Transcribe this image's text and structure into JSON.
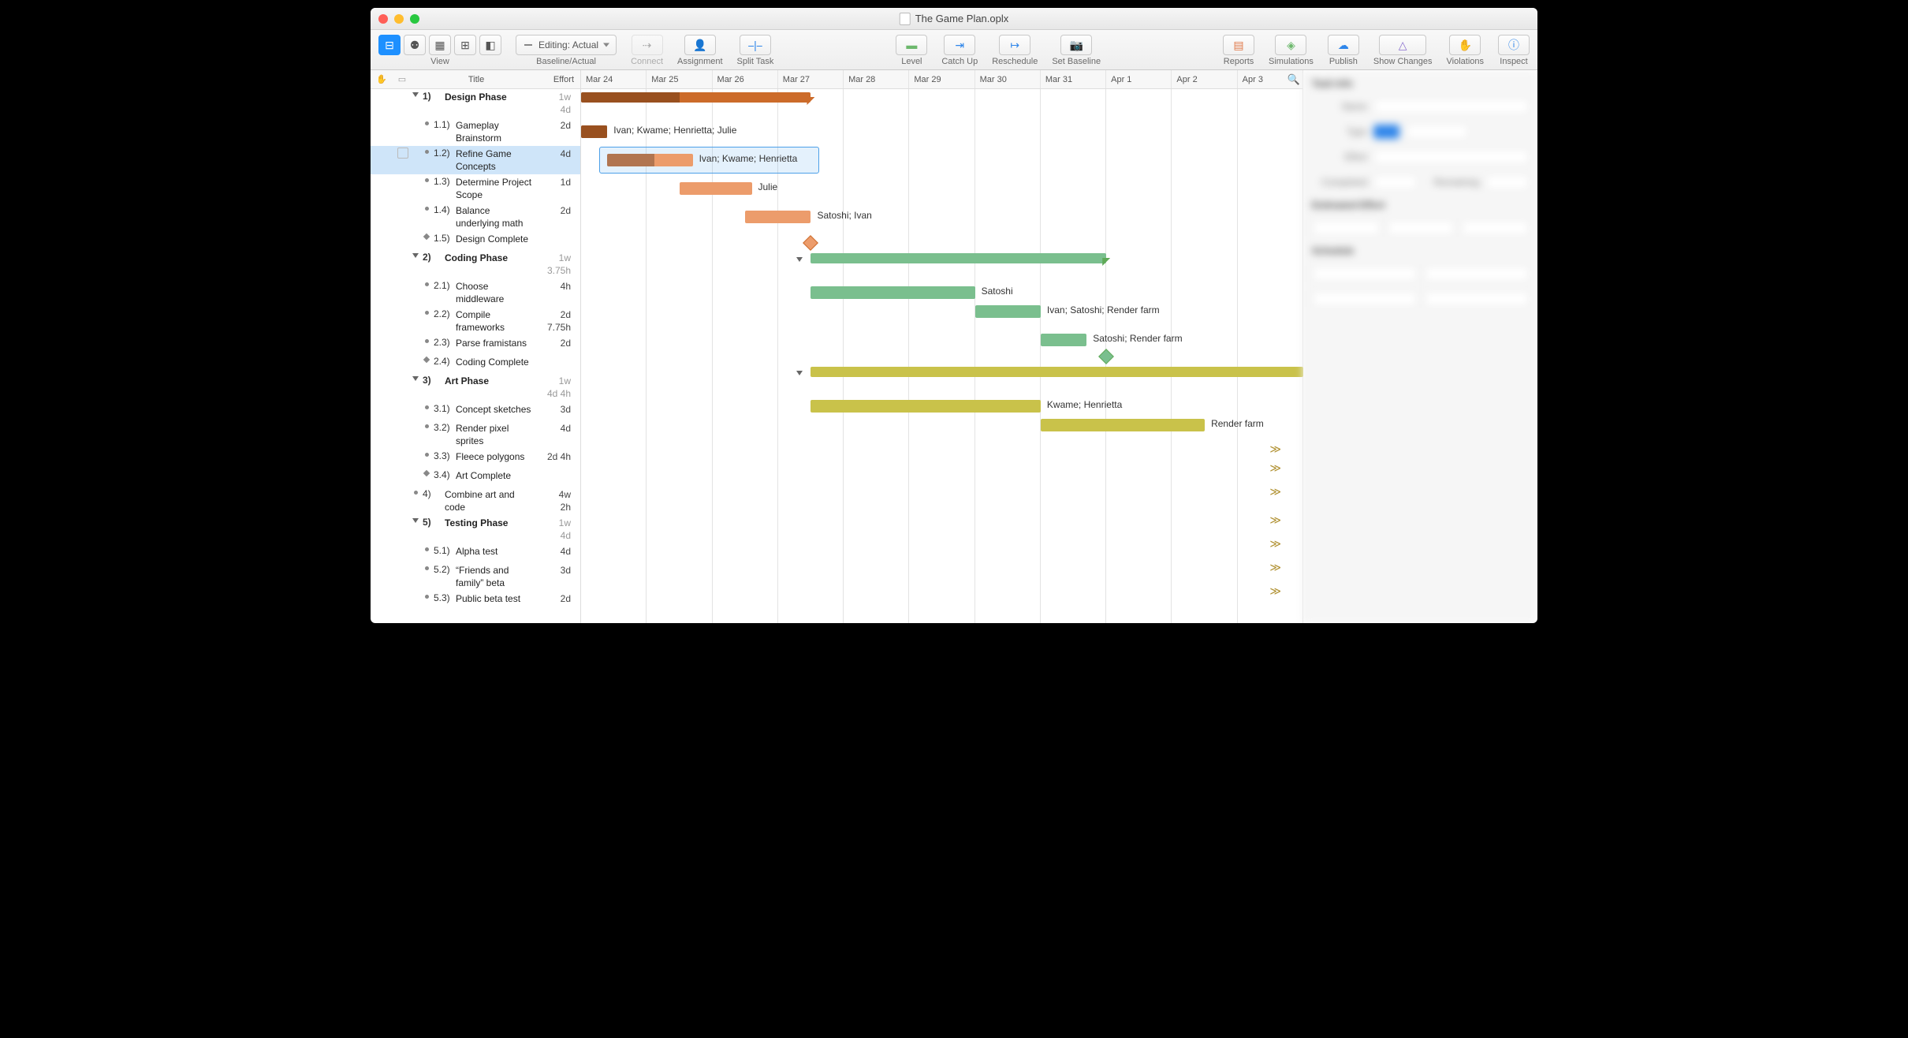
{
  "window": {
    "title": "The Game Plan.oplx"
  },
  "toolbar": {
    "view_label": "View",
    "baseline_label": "Baseline/Actual",
    "baseline_dropdown": "Editing: Actual",
    "connect_label": "Connect",
    "assignment_label": "Assignment",
    "split_label": "Split Task",
    "level_label": "Level",
    "catchup_label": "Catch Up",
    "reschedule_label": "Reschedule",
    "setbaseline_label": "Set Baseline",
    "reports_label": "Reports",
    "simulations_label": "Simulations",
    "publish_label": "Publish",
    "showchanges_label": "Show Changes",
    "violations_label": "Violations",
    "inspect_label": "Inspect"
  },
  "outline_header": {
    "title": "Title",
    "effort": "Effort"
  },
  "gantt_header": {
    "dates": [
      "Mar 24",
      "Mar 25",
      "Mar 26",
      "Mar 27",
      "Mar 28",
      "Mar 29",
      "Mar 30",
      "Mar 31",
      "Apr 1",
      "Apr 2",
      "Apr 3"
    ]
  },
  "rows": [
    {
      "id": "1",
      "type": "group",
      "num": "1)",
      "title": "Design Phase",
      "eff": "1w",
      "eff2": "4d"
    },
    {
      "id": "1.1",
      "type": "task",
      "num": "1.1)",
      "title": "Gameplay Brainstorm",
      "eff": "2d"
    },
    {
      "id": "1.2",
      "type": "task",
      "num": "1.2)",
      "title": "Refine Game Concepts",
      "eff": "4d",
      "selected": true
    },
    {
      "id": "1.3",
      "type": "task",
      "num": "1.3)",
      "title": "Determine Project Scope",
      "eff": "1d"
    },
    {
      "id": "1.4",
      "type": "task",
      "num": "1.4)",
      "title": "Balance underlying math",
      "eff": "2d"
    },
    {
      "id": "1.5",
      "type": "mile",
      "num": "1.5)",
      "title": "Design Complete",
      "eff": ""
    },
    {
      "id": "2",
      "type": "group",
      "num": "2)",
      "title": "Coding Phase",
      "eff": "1w",
      "eff2": "3.75h"
    },
    {
      "id": "2.1",
      "type": "task",
      "num": "2.1)",
      "title": "Choose middleware",
      "eff": "4h"
    },
    {
      "id": "2.2",
      "type": "task",
      "num": "2.2)",
      "title": "Compile frameworks",
      "eff": "2d",
      "eff2": "7.75h"
    },
    {
      "id": "2.3",
      "type": "task",
      "num": "2.3)",
      "title": "Parse framistans",
      "eff": "2d"
    },
    {
      "id": "2.4",
      "type": "mile",
      "num": "2.4)",
      "title": "Coding Complete",
      "eff": ""
    },
    {
      "id": "3",
      "type": "group",
      "num": "3)",
      "title": "Art Phase",
      "eff": "1w",
      "eff2": "4d 4h"
    },
    {
      "id": "3.1",
      "type": "task",
      "num": "3.1)",
      "title": "Concept sketches",
      "eff": "3d"
    },
    {
      "id": "3.2",
      "type": "task",
      "num": "3.2)",
      "title": "Render pixel sprites",
      "eff": "4d"
    },
    {
      "id": "3.3",
      "type": "task",
      "num": "3.3)",
      "title": "Fleece polygons",
      "eff": "2d 4h"
    },
    {
      "id": "3.4",
      "type": "mile",
      "num": "3.4)",
      "title": "Art Complete",
      "eff": ""
    },
    {
      "id": "4",
      "type": "task",
      "num": "4)",
      "title": "Combine art and code",
      "eff": "4w",
      "eff2": "2h",
      "toplevel": true
    },
    {
      "id": "5",
      "type": "group",
      "num": "5)",
      "title": "Testing Phase",
      "eff": "1w",
      "eff2": "4d"
    },
    {
      "id": "5.1",
      "type": "task",
      "num": "5.1)",
      "title": "Alpha test",
      "eff": "4d"
    },
    {
      "id": "5.2",
      "type": "task",
      "num": "5.2)",
      "title": "“Friends and family” beta",
      "eff": "3d"
    },
    {
      "id": "5.3",
      "type": "task",
      "num": "5.3)",
      "title": "Public beta test",
      "eff": "2d"
    }
  ],
  "bar_labels": {
    "1.1": "Ivan; Kwame; Henrietta; Julie",
    "1.2": "Ivan; Kwame; Henrietta",
    "1.3": "Julie",
    "1.4": "Satoshi; Ivan",
    "2.1": "Satoshi",
    "2.2": "Ivan; Satoshi; Render farm",
    "2.3": "Satoshi; Render farm",
    "3.1": "Kwame; Henrietta",
    "3.2": "Render farm"
  },
  "inspector": {
    "section1": "Task Info",
    "name_label": "Name",
    "name_value": "Refine Game Concepts",
    "type_label": "Type",
    "effort_label": "Effort",
    "completed_label": "Completed",
    "remaining_label": "Remaining",
    "section2": "Estimated Effort",
    "section3": "Schedule"
  },
  "chart_data": {
    "type": "gantt",
    "x_dates": [
      "Mar 24",
      "Mar 25",
      "Mar 26",
      "Mar 27",
      "Mar 28",
      "Mar 29",
      "Mar 30",
      "Mar 31",
      "Apr 1",
      "Apr 2",
      "Apr 3"
    ],
    "groups": [
      {
        "id": "1",
        "name": "Design Phase",
        "color": "#cc6b2a",
        "start": "Mar 24",
        "end": "Mar 27.5",
        "progress": 0.43
      },
      {
        "id": "2",
        "name": "Coding Phase",
        "color": "#5fa957",
        "start": "Mar 27.5",
        "end": "Apr 1",
        "progress": 0
      },
      {
        "id": "3",
        "name": "Art Phase",
        "color": "#b4ad33",
        "start": "Mar 27.5",
        "end": "Apr 3+",
        "progress": 0
      }
    ],
    "tasks": [
      {
        "id": "1.1",
        "start": "Mar 24",
        "end": "Mar 24.4",
        "color": "#cc6b2a",
        "progress": 1,
        "assignees": "Ivan; Kwame; Henrietta; Julie"
      },
      {
        "id": "1.2",
        "start": "Mar 24.4",
        "end": "Mar 25.7",
        "color": "#ec9c6b",
        "progress": 0.55,
        "assignees": "Ivan; Kwame; Henrietta",
        "selected": true
      },
      {
        "id": "1.3",
        "start": "Mar 25.5",
        "end": "Mar 26.6",
        "color": "#ec9c6b",
        "progress": 0,
        "assignees": "Julie"
      },
      {
        "id": "1.4",
        "start": "Mar 26.5",
        "end": "Mar 27.5",
        "color": "#ec9c6b",
        "progress": 0,
        "assignees": "Satoshi; Ivan"
      },
      {
        "id": "1.5",
        "milestone": true,
        "at": "Mar 27.5",
        "color": "#ec9c6b"
      },
      {
        "id": "2.1",
        "start": "Mar 27.5",
        "end": "Mar 30",
        "color": "#7abf8e",
        "progress": 0,
        "assignees": "Satoshi"
      },
      {
        "id": "2.2",
        "start": "Mar 30",
        "end": "Mar 31",
        "color": "#7abf8e",
        "progress": 0,
        "assignees": "Ivan; Satoshi; Render farm"
      },
      {
        "id": "2.3",
        "start": "Mar 31",
        "end": "Mar 31.7",
        "color": "#7abf8e",
        "progress": 0,
        "assignees": "Satoshi; Render farm"
      },
      {
        "id": "2.4",
        "milestone": true,
        "at": "Apr 1",
        "color": "#7abf8e"
      },
      {
        "id": "3.1",
        "start": "Mar 27.5",
        "end": "Mar 31",
        "color": "#c9c24a",
        "progress": 0,
        "assignees": "Kwame; Henrietta"
      },
      {
        "id": "3.2",
        "start": "Mar 31",
        "end": "Apr 2.5",
        "color": "#c9c24a",
        "progress": 0,
        "assignees": "Render farm"
      },
      {
        "id": "3.3",
        "offscreen": true
      },
      {
        "id": "3.4",
        "offscreen": true
      },
      {
        "id": "4",
        "offscreen": true
      },
      {
        "id": "5",
        "offscreen": true
      },
      {
        "id": "5.1",
        "offscreen": true
      },
      {
        "id": "5.2",
        "offscreen": true
      },
      {
        "id": "5.3",
        "offscreen": true
      }
    ]
  }
}
